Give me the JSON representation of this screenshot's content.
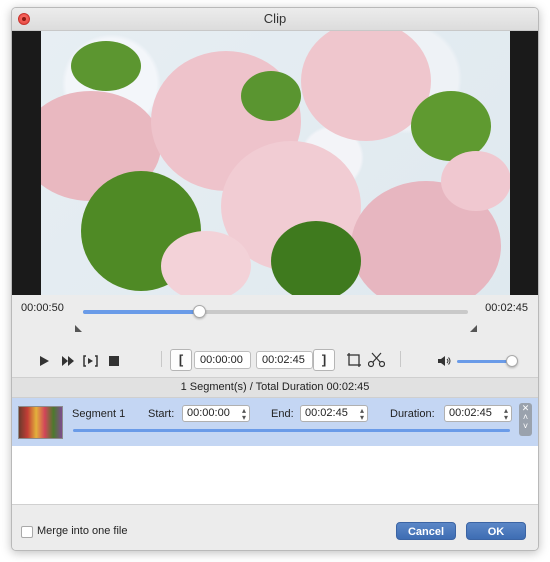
{
  "window": {
    "title": "Clip"
  },
  "timeline": {
    "current_time": "00:00:50",
    "total_time": "00:02:45",
    "progress": 0.3
  },
  "controls": {
    "play_icon": "play-icon",
    "fast_forward_icon": "fast-forward-icon",
    "play_segment_icon": "play-segment-icon",
    "stop_icon": "stop-icon",
    "set_start_label": "[",
    "start_time": "00:00:00",
    "end_time": "00:02:45",
    "set_end_label": "]",
    "volume_level": 0.95
  },
  "segments": {
    "summary": "1 Segment(s) / Total Duration 00:02:45",
    "items": [
      {
        "name": "Segment 1",
        "start_label": "Start:",
        "start": "00:00:00",
        "end_label": "End:",
        "end": "00:02:45",
        "duration_label": "Duration:",
        "duration": "00:02:45"
      }
    ]
  },
  "footer": {
    "merge_label": "Merge into one file",
    "merge_checked": false,
    "cancel_label": "Cancel",
    "ok_label": "OK"
  },
  "colors": {
    "accent": "#6a9be8",
    "button": "#4a78bd",
    "selection": "#c4d6f3"
  }
}
